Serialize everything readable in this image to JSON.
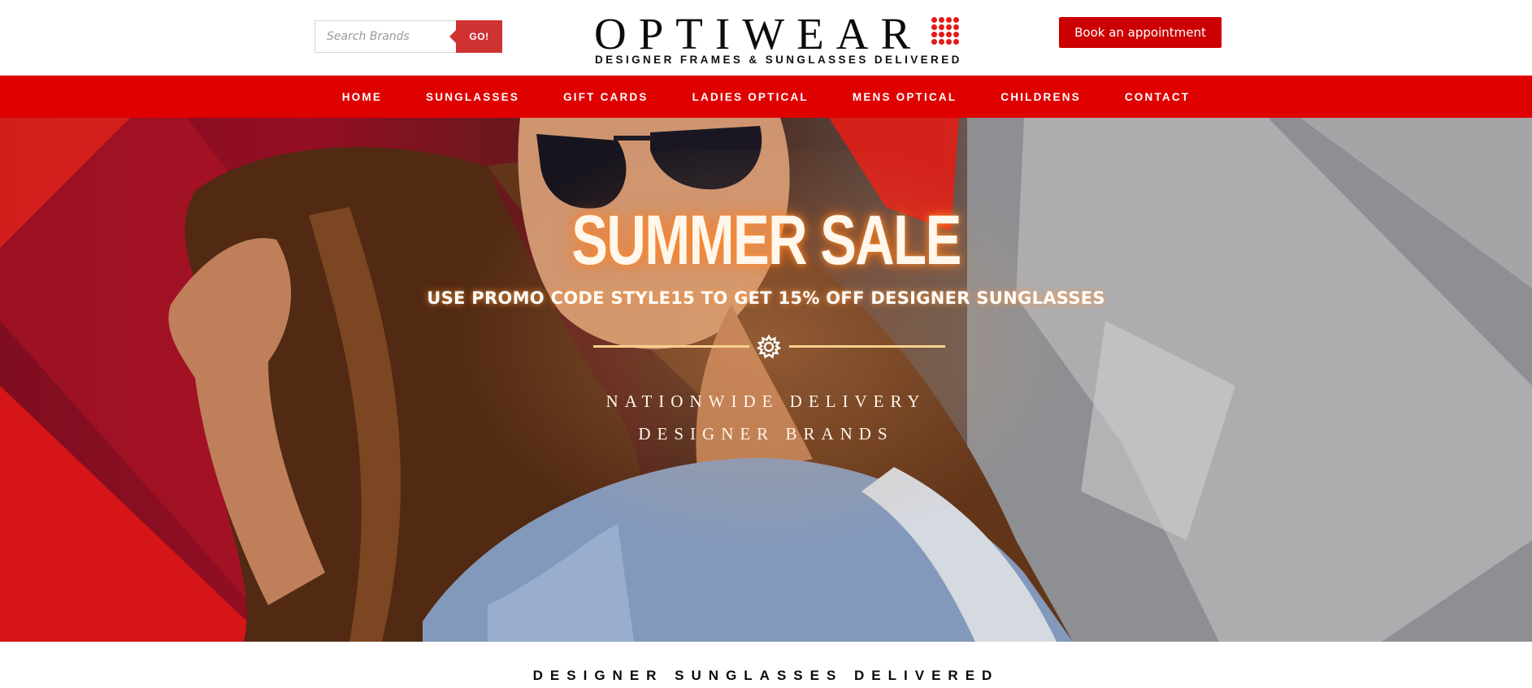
{
  "header": {
    "search": {
      "placeholder": "Search Brands",
      "value": ""
    },
    "go_label": "GO!",
    "logo": {
      "wordmark": "OPTIWEAR",
      "tagline": "DESIGNER FRAMES & SUNGLASSES DELIVERED"
    },
    "book_label": "Book an appointment"
  },
  "nav": {
    "items": [
      {
        "label": "HOME"
      },
      {
        "label": "SUNGLASSES"
      },
      {
        "label": "GIFT CARDS"
      },
      {
        "label": "LADIES OPTICAL"
      },
      {
        "label": "MENS OPTICAL"
      },
      {
        "label": "CHILDRENS"
      },
      {
        "label": "CONTACT"
      }
    ]
  },
  "hero": {
    "title": "SUMMER SALE",
    "promo": "USE PROMO CODE STYLE15 TO GET 15% OFF DESIGNER SUNGLASSES",
    "divider_icon": "gear-icon",
    "feature_1": "NATIONWIDE DELIVERY",
    "feature_2": "DESIGNER BRANDS"
  },
  "section": {
    "heading": "DESIGNER SUNGLASSES DELIVERED"
  },
  "colors": {
    "brand_red": "#df0000",
    "button_red": "#cc0000",
    "go_red": "#d03232",
    "accent_gold": "#f6d28e",
    "logo_dot_red": "#e11b1b"
  }
}
